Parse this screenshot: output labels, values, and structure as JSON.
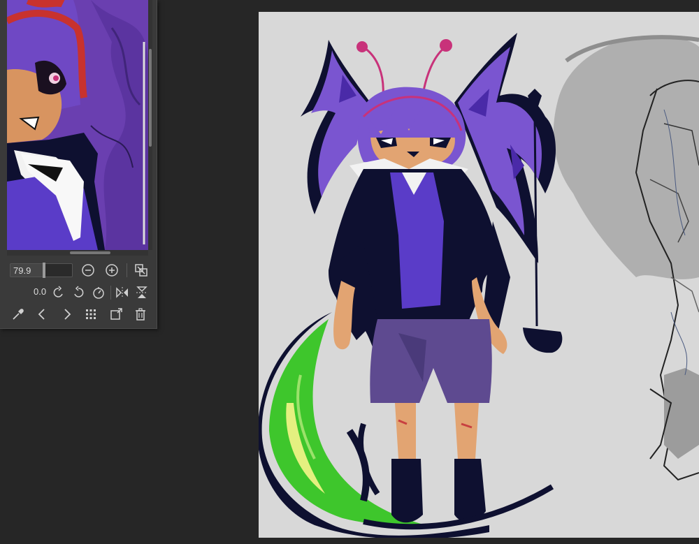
{
  "navigator": {
    "zoom_value": "79.9",
    "rotation_value": "0.0",
    "controls": {
      "zoom_out": "zoom-out-icon",
      "zoom_in": "zoom-in-icon",
      "fit": "fit-to-window-icon",
      "rotate_left": "rotate-left-icon",
      "rotate_right": "rotate-right-icon",
      "reset_rotation": "reset-rotation-icon",
      "flip_horizontal": "flip-horizontal-icon",
      "flip_vertical": "flip-vertical-icon",
      "eyedropper": "eyedropper-icon",
      "previous": "chevron-left-icon",
      "next": "chevron-right-icon",
      "grid": "grid-icon",
      "new_navigator": "new-window-icon",
      "delete": "trash-icon"
    }
  },
  "colors": {
    "workspace_bg": "#262626",
    "panel_bg": "#3a3a3a",
    "canvas_bg": "#d8d8d8",
    "hair_purple": "#7a55d0",
    "outfit_navy": "#0e1030",
    "shirt_purple": "#5a3cc8",
    "shorts_purple": "#5e4a90",
    "skin": "#e2a472",
    "antenna_pink": "#c8327a",
    "tail_green": "#3ec62c",
    "tail_light": "#e4f080",
    "sketch_gray": "#a8a8a8"
  }
}
